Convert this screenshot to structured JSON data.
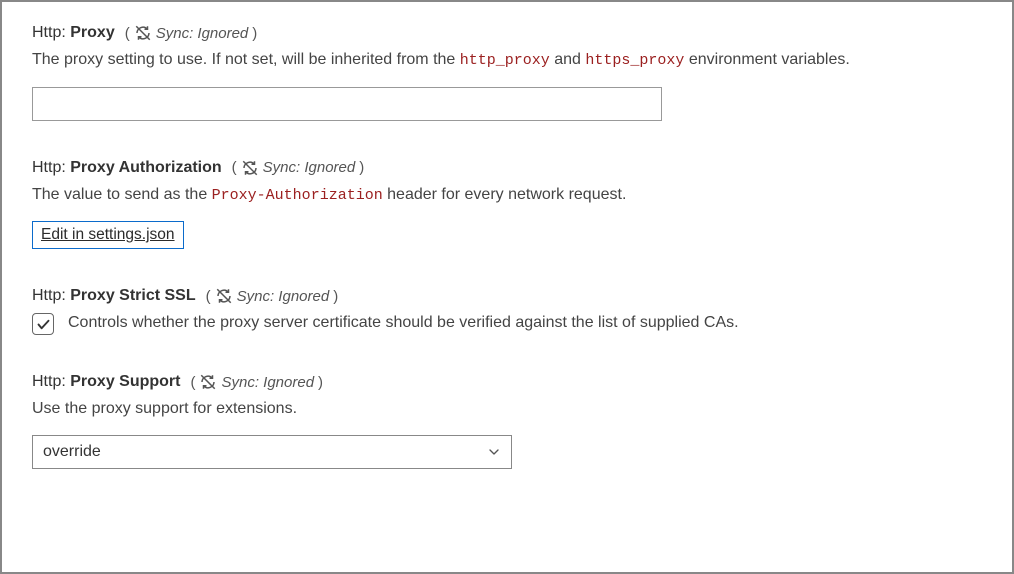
{
  "sync_label": "Sync: Ignored",
  "settings": {
    "proxy": {
      "prefix": "Http:",
      "name": "Proxy",
      "desc_pre": "The proxy setting to use. If not set, will be inherited from the ",
      "code1": "http_proxy",
      "desc_mid": " and ",
      "code2": "https_proxy",
      "desc_post": " environment variables.",
      "value": ""
    },
    "proxyAuth": {
      "prefix": "Http:",
      "name": "Proxy Authorization",
      "desc_pre": "The value to send as the ",
      "code1": "Proxy-Authorization",
      "desc_post": " header for every network request.",
      "edit_label": "Edit in settings.json"
    },
    "proxyStrict": {
      "prefix": "Http:",
      "name": "Proxy Strict SSL",
      "desc": "Controls whether the proxy server certificate should be verified against the list of supplied CAs.",
      "checked": true
    },
    "proxySupport": {
      "prefix": "Http:",
      "name": "Proxy Support",
      "desc": "Use the proxy support for extensions.",
      "value": "override"
    }
  }
}
